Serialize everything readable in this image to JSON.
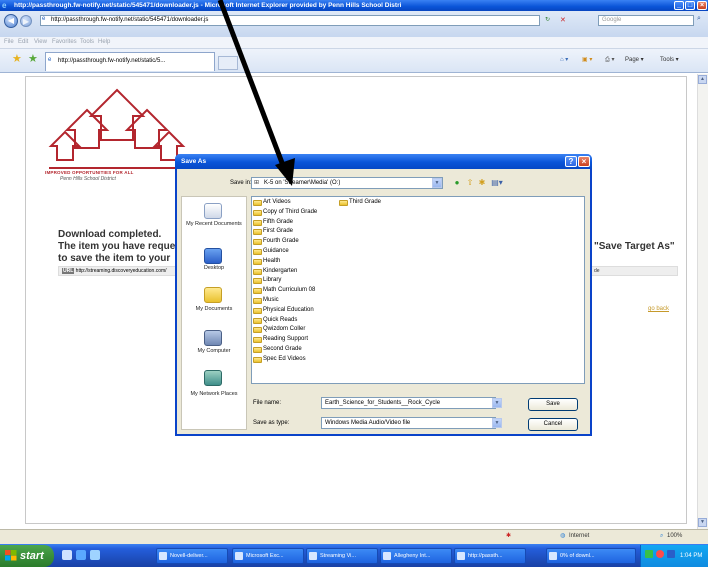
{
  "window": {
    "title": "http://passthrough.fw-notify.net/static/545471/downloader.js - Microsoft Internet Explorer provided by Penn Hills School Distri",
    "minimize": "_",
    "maximize": "□",
    "close": "×"
  },
  "address_bar": {
    "url": "http://passthrough.fw-notify.net/static/545471/downloader.js",
    "search_placeholder": "Google",
    "refresh": "↻",
    "stop": "✕"
  },
  "menu": [
    "File",
    "Edit",
    "View",
    "Favorites",
    "Tools",
    "Help"
  ],
  "tab": {
    "label": "http://passthrough.fw-notify.net/static/5..."
  },
  "toolbar": {
    "page": "Page ▾",
    "tools": "Tools ▾"
  },
  "page": {
    "logo_line1": "IMPROVED OPPORTUNITIES FOR ALL",
    "logo_line2": "Penn Hills School District",
    "heading": "Download completed.",
    "line1": "The item you have requested",
    "line2": "to save the item to your",
    "line_right": "\"Save Target As\"",
    "url_tag": "URL",
    "url": "http://streaming.discoveryeducation.com/",
    "url_right": "de",
    "go_back": "go back"
  },
  "dialog": {
    "title": "Save As",
    "help": "?",
    "close": "×",
    "save_in_label": "Save in:",
    "save_in_value": "K-5 on 'Streamer\\Media' (O:)",
    "places": [
      "My Recent Documents",
      "Desktop",
      "My Documents",
      "My Computer",
      "My Network Places"
    ],
    "folders_col1": [
      "Art Videos",
      "Copy of Third Grade",
      "Fifth Grade",
      "First Grade",
      "Fourth Grade",
      "Guidance",
      "Health",
      "Kindergarten",
      "Library",
      "Math Curriculum 08",
      "Music",
      "Physical Education",
      "Quick Reads",
      "Qwizdom Coller",
      "Reading Support",
      "Second Grade",
      "Spec Ed Videos"
    ],
    "folders_col2": [
      "Third Grade"
    ],
    "file_name_label": "File name:",
    "file_name_value": "Earth_Science_for_Students__Rock_Cycle",
    "save_type_label": "Save as type:",
    "save_type_value": "Windows Media Audio/Video file",
    "save_button": "Save",
    "cancel_button": "Cancel"
  },
  "status": {
    "zone": "Internet",
    "zoom": "100%"
  },
  "taskbar": {
    "start": "start",
    "tasks": [
      "Novell-deliver...",
      "Microsoft Exc...",
      "Streaming Vi...",
      "Allegheny Int...",
      "http://passth...",
      "0% of downl..."
    ],
    "clock": "1:04 PM"
  },
  "colors": {
    "xp_blue": "#0a54d8",
    "dialog_bg": "#ece9d8",
    "folder_yellow": "#e9c12d",
    "logo_red": "#b3262e"
  }
}
